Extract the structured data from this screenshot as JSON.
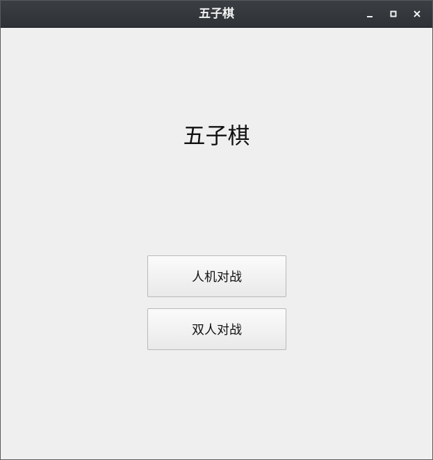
{
  "window": {
    "title": "五子棋",
    "controls": {
      "minimize_icon": "minimize-icon",
      "maximize_icon": "maximize-icon",
      "close_icon": "close-icon"
    }
  },
  "main": {
    "heading": "五子棋",
    "buttons": {
      "pve_label": "人机对战",
      "pvp_label": "双人对战"
    }
  },
  "colors": {
    "titlebar": "#2e3236",
    "background": "#efefef",
    "button_border": "#b8b8b8"
  }
}
